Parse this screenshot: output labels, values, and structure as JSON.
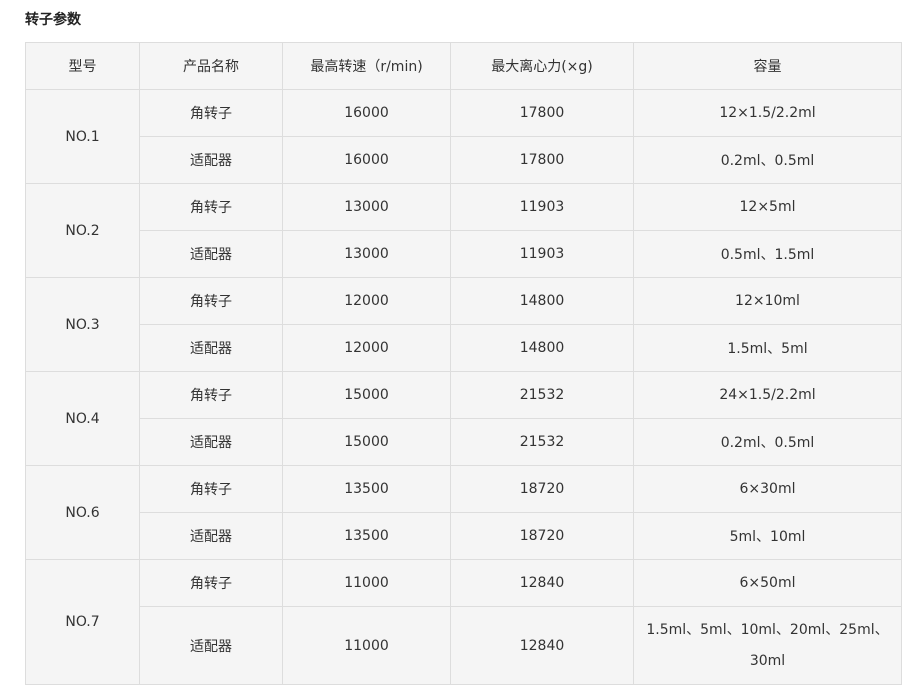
{
  "section_title": "转子参数",
  "table": {
    "headers": [
      "型号",
      "产品名称",
      "最高转速（r/min)",
      "最大离心力(×g)",
      "容量"
    ],
    "groups": [
      {
        "model": "NO.1",
        "rows": [
          {
            "name": "角转子",
            "speed": "16000",
            "force": "17800",
            "capacity": "12×1.5/2.2ml"
          },
          {
            "name": "适配器",
            "speed": "16000",
            "force": "17800",
            "capacity": "0.2ml、0.5ml"
          }
        ]
      },
      {
        "model": "NO.2",
        "rows": [
          {
            "name": "角转子",
            "speed": "13000",
            "force": "11903",
            "capacity": "12×5ml"
          },
          {
            "name": "适配器",
            "speed": "13000",
            "force": "11903",
            "capacity": "0.5ml、1.5ml"
          }
        ]
      },
      {
        "model": "NO.3",
        "rows": [
          {
            "name": "角转子",
            "speed": "12000",
            "force": "14800",
            "capacity": "12×10ml"
          },
          {
            "name": "适配器",
            "speed": "12000",
            "force": "14800",
            "capacity": "1.5ml、5ml"
          }
        ]
      },
      {
        "model": "NO.4",
        "rows": [
          {
            "name": "角转子",
            "speed": "15000",
            "force": "21532",
            "capacity": "24×1.5/2.2ml"
          },
          {
            "name": "适配器",
            "speed": "15000",
            "force": "21532",
            "capacity": "0.2ml、0.5ml"
          }
        ]
      },
      {
        "model": "NO.6",
        "rows": [
          {
            "name": "角转子",
            "speed": "13500",
            "force": "18720",
            "capacity": "6×30ml"
          },
          {
            "name": "适配器",
            "speed": "13500",
            "force": "18720",
            "capacity": "5ml、10ml"
          }
        ]
      },
      {
        "model": "NO.7",
        "rows": [
          {
            "name": "角转子",
            "speed": "11000",
            "force": "12840",
            "capacity": "6×50ml"
          },
          {
            "name": "适配器",
            "speed": "11000",
            "force": "12840",
            "capacity": "1.5ml、5ml、10ml、20ml、25ml、30ml"
          }
        ]
      }
    ]
  }
}
